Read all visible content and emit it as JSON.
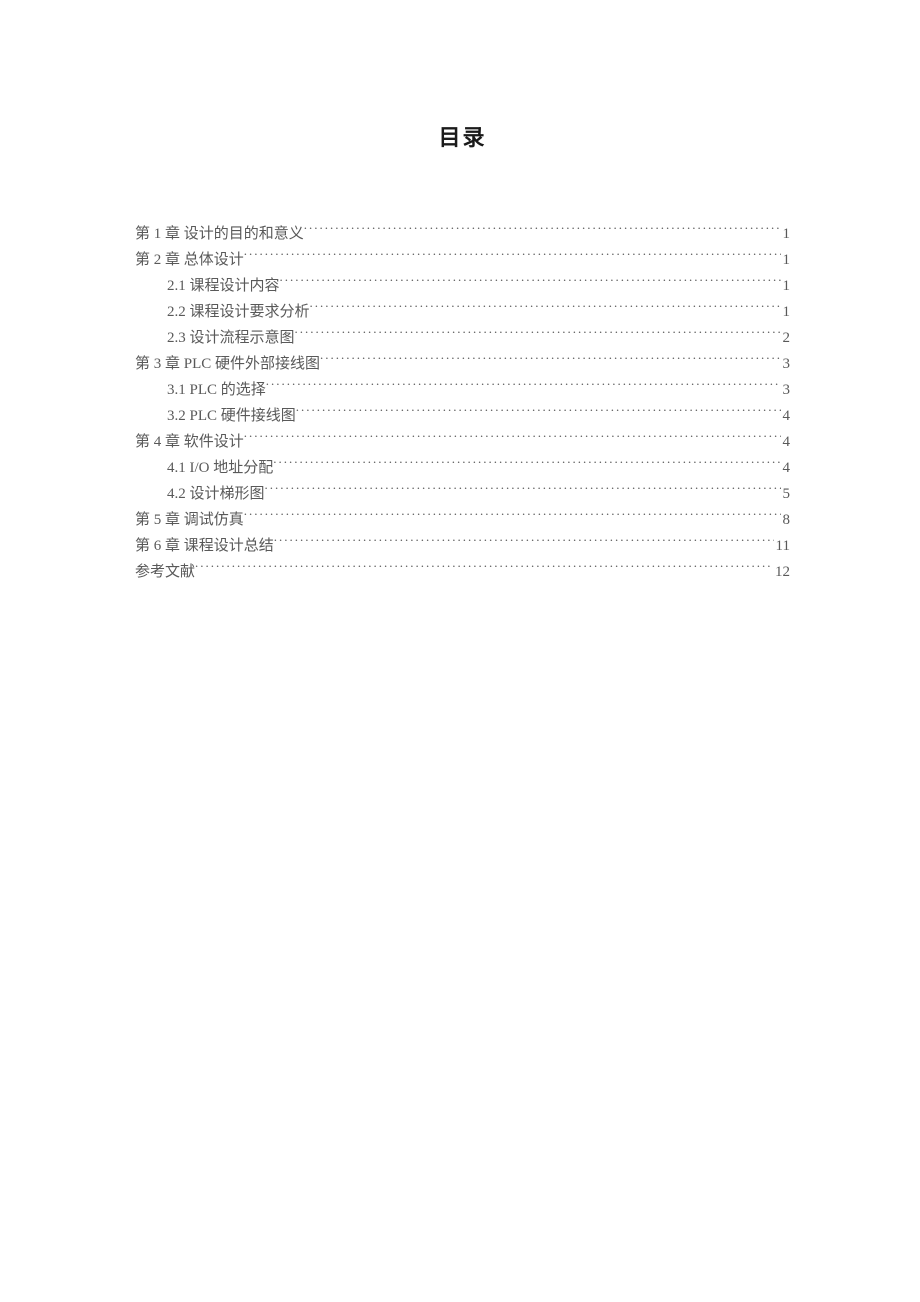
{
  "title": "目录",
  "entries": [
    {
      "text": "第 1 章   设计的目的和意义",
      "page": "1",
      "indent": false
    },
    {
      "text": "第 2 章 总体设计",
      "page": "1",
      "indent": false
    },
    {
      "text": "2.1 课程设计内容",
      "page": "1",
      "indent": true
    },
    {
      "text": "2.2 课程设计要求分析",
      "page": "1",
      "indent": true
    },
    {
      "text": "2.3 设计流程示意图",
      "page": "2",
      "indent": true
    },
    {
      "text": "第 3 章 PLC 硬件外部接线图",
      "page": "3",
      "indent": false
    },
    {
      "text": "3.1   PLC 的选择",
      "page": "3",
      "indent": true
    },
    {
      "text": "3.2   PLC 硬件接线图",
      "page": "4",
      "indent": true
    },
    {
      "text": "第 4 章   软件设计",
      "page": "4",
      "indent": false
    },
    {
      "text": "4.1   I/O 地址分配",
      "page": "4",
      "indent": true
    },
    {
      "text": "4.2 设计梯形图",
      "page": "5",
      "indent": true
    },
    {
      "text": "第 5 章 调试仿真",
      "page": "8",
      "indent": false
    },
    {
      "text": "第 6 章 课程设计总结",
      "page": "11",
      "indent": false
    },
    {
      "text": "参考文献",
      "page": "12",
      "indent": false
    }
  ]
}
